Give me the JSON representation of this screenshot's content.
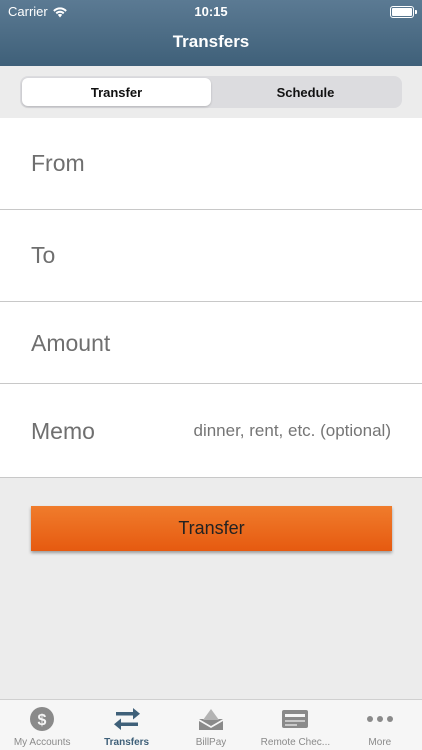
{
  "status_bar": {
    "carrier": "Carrier",
    "time": "10:15"
  },
  "nav": {
    "title": "Transfers"
  },
  "segments": [
    {
      "label": "Transfer",
      "active": true
    },
    {
      "label": "Schedule",
      "active": false
    }
  ],
  "form": {
    "from_label": "From",
    "to_label": "To",
    "amount_label": "Amount",
    "memo_label": "Memo",
    "memo_placeholder": "dinner, rent, etc. (optional)"
  },
  "transfer_button": {
    "label": "Transfer",
    "color": "#eb6a1b"
  },
  "tabs": [
    {
      "label": "My Accounts",
      "icon": "dollar-circle-icon",
      "active": false
    },
    {
      "label": "Transfers",
      "icon": "transfer-arrows-icon",
      "active": true
    },
    {
      "label": "BillPay",
      "icon": "envelope-icon",
      "active": false
    },
    {
      "label": "Remote Chec...",
      "icon": "check-card-icon",
      "active": false
    },
    {
      "label": "More",
      "icon": "more-dots-icon",
      "active": false
    }
  ],
  "colors": {
    "nav_bar": "#4d6d86",
    "accent": "#3f6079",
    "button": "#eb6a1b"
  }
}
